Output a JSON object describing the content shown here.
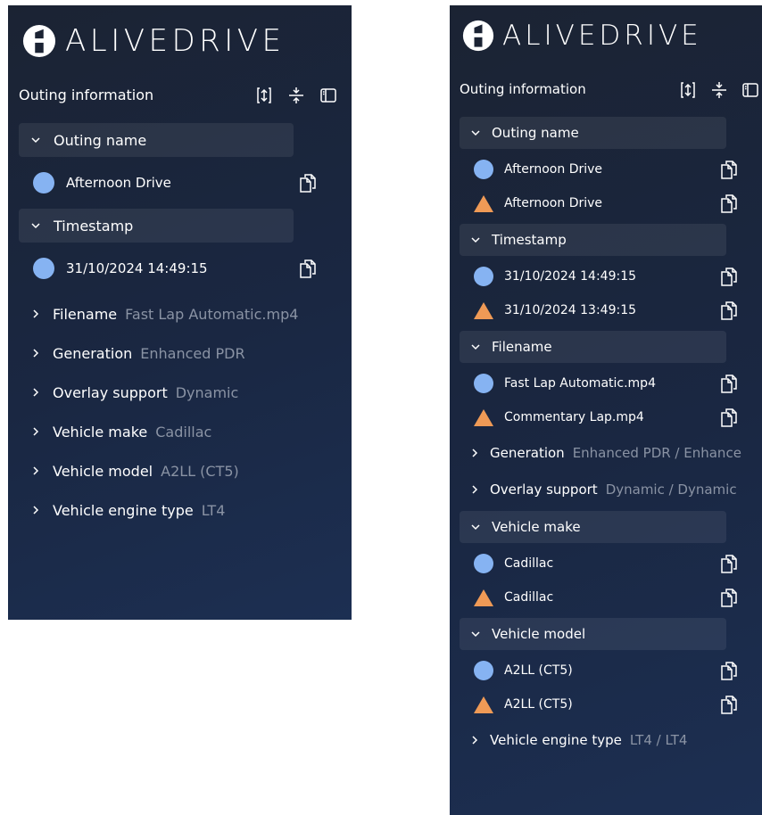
{
  "logo_text": "ALIVEDRIVE",
  "colors": {
    "blue_marker": "#86b3f2",
    "orange_marker": "#ef9a56",
    "muted_text": "#8a93a4"
  },
  "icons": [
    "logo-mark",
    "swap-vertical-icon",
    "compress-vertical-icon",
    "sidebar-panel-icon",
    "chevron-down-icon",
    "chevron-right-icon",
    "copy-icon"
  ],
  "left_panel": {
    "header_title": "Outing information",
    "expanded": [
      {
        "title": "Outing name",
        "values": [
          "Afternoon Drive"
        ]
      },
      {
        "title": "Timestamp",
        "values": [
          "31/10/2024 14:49:15"
        ]
      }
    ],
    "collapsed": [
      {
        "label": "Filename",
        "value": "Fast Lap Automatic.mp4"
      },
      {
        "label": "Generation",
        "value": "Enhanced PDR"
      },
      {
        "label": "Overlay support",
        "value": "Dynamic"
      },
      {
        "label": "Vehicle make",
        "value": "Cadillac"
      },
      {
        "label": "Vehicle model",
        "value": "A2LL (CT5)"
      },
      {
        "label": "Vehicle engine type",
        "value": "LT4"
      }
    ]
  },
  "right_panel": {
    "header_title": "Outing information",
    "sections": {
      "outing_name": {
        "title": "Outing name",
        "blue": "Afternoon Drive",
        "orange": "Afternoon Drive"
      },
      "timestamp": {
        "title": "Timestamp",
        "blue": "31/10/2024 14:49:15",
        "orange": "31/10/2024 13:49:15"
      },
      "filename": {
        "title": "Filename",
        "blue": "Fast Lap Automatic.mp4",
        "orange": "Commentary Lap.mp4"
      },
      "generation": {
        "label": "Generation",
        "value": "Enhanced PDR / Enhance"
      },
      "overlay_support": {
        "label": "Overlay support",
        "value": "Dynamic / Dynamic"
      },
      "vehicle_make": {
        "title": "Vehicle make",
        "blue": "Cadillac",
        "orange": "Cadillac"
      },
      "vehicle_model": {
        "title": "Vehicle model",
        "blue": "A2LL (CT5)",
        "orange": "A2LL (CT5)"
      },
      "vehicle_engine_type": {
        "label": "Vehicle engine type",
        "value": "LT4 / LT4"
      }
    }
  }
}
